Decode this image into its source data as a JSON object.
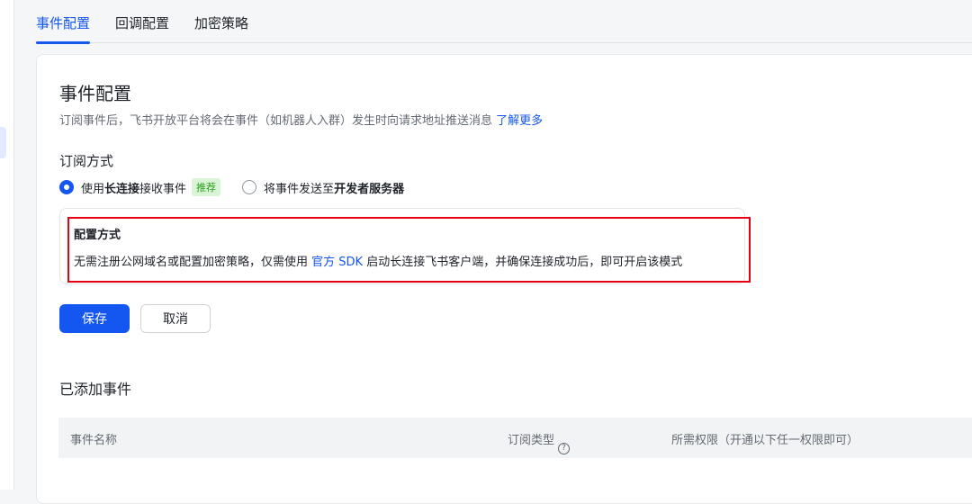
{
  "tabs": [
    "事件配置",
    "回调配置",
    "加密策略"
  ],
  "title": "事件配置",
  "desc": "订阅事件后，飞书开放平台将会在事件（如机器人入群）发生时向请求地址推送消息",
  "learn_more": "了解更多",
  "subscribe_title": "订阅方式",
  "radio1": {
    "pre": "使用 ",
    "bold": "长连接",
    "post": " 接收事件",
    "badge": "推荐",
    "selected": true
  },
  "radio2": {
    "pre": "将事件发送至 ",
    "bold": "开发者服务器",
    "selected": false
  },
  "config": {
    "title": "配置方式",
    "pre": "无需注册公网域名或配置加密策略，仅需使用 ",
    "link": "官方 SDK",
    "post": " 启动长连接飞书客户端，并确保连接成功后，即可开启该模式"
  },
  "save": "保存",
  "cancel": "取消",
  "added_title": "已添加事件",
  "columns": [
    "事件名称",
    "订阅类型",
    "所需权限（开通以下任一权限即可）"
  ],
  "help_icon": "?"
}
